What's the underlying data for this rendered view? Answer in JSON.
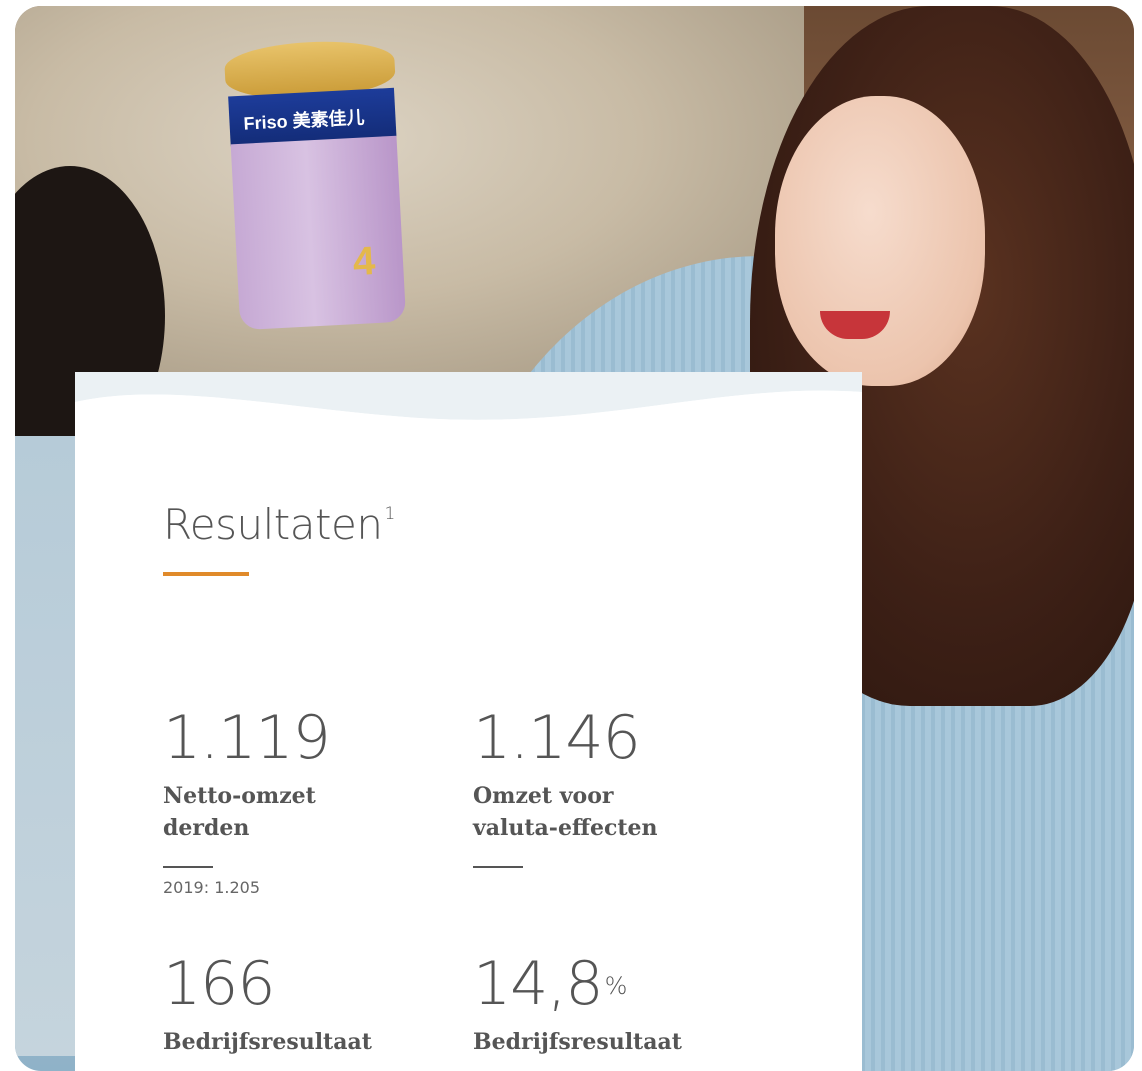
{
  "product": {
    "brand": "Friso 美素佳儿",
    "stage": "4"
  },
  "section": {
    "title": "Resultaten",
    "footnote": "1"
  },
  "kpis": [
    {
      "value": "1.119",
      "label_lines": [
        "Netto-omzet",
        "derden"
      ],
      "comparison": "2019: 1.205"
    },
    {
      "value": "1.146",
      "label_lines": [
        "Omzet voor",
        "valuta-effecten"
      ],
      "comparison": ""
    },
    {
      "value": "166",
      "label_lines": [
        "Bedrijfsresultaat"
      ],
      "comparison": ""
    },
    {
      "value": "14,8",
      "unit": "%",
      "label_lines": [
        "Bedrijfsresultaat"
      ],
      "comparison": ""
    }
  ],
  "colors": {
    "accent": "#e08a2a",
    "text": "#555555",
    "card": "#ffffff"
  }
}
